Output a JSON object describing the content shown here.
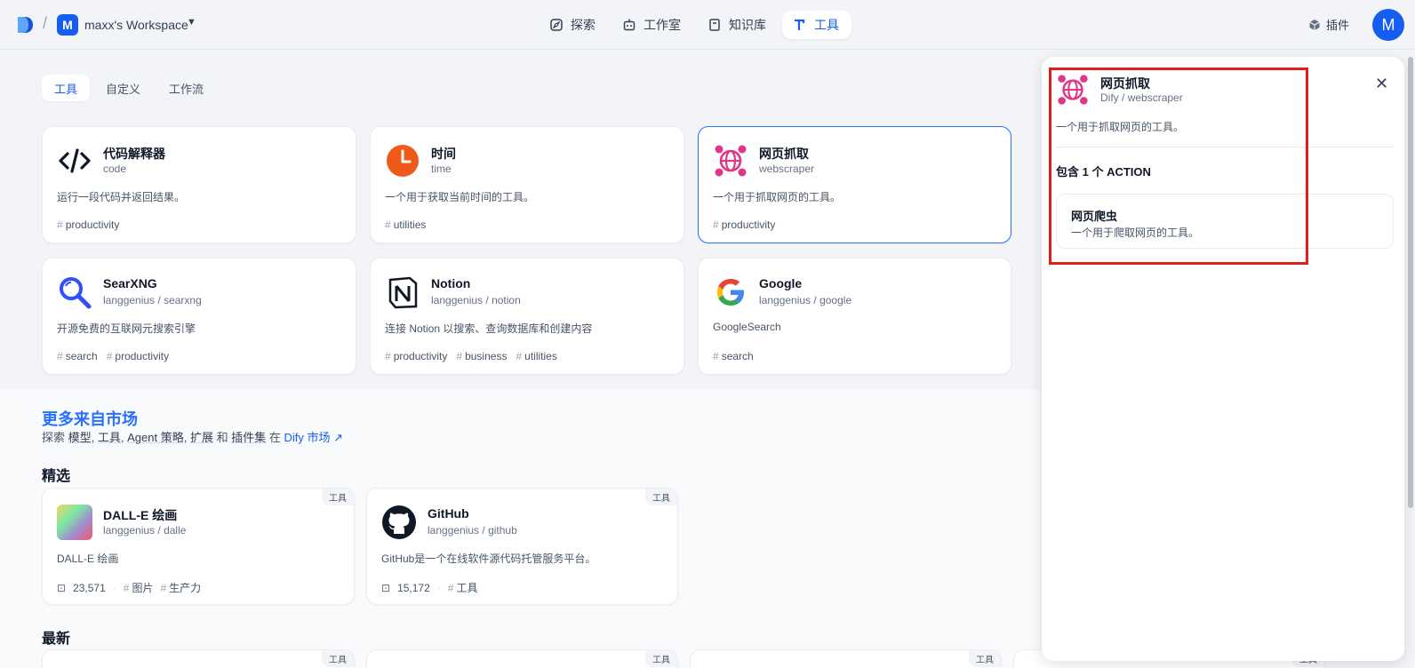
{
  "header": {
    "workspace_initial": "M",
    "workspace_name": "maxx's Workspace",
    "nav": [
      {
        "label": "探索",
        "icon": "compass-icon"
      },
      {
        "label": "工作室",
        "icon": "robot-icon"
      },
      {
        "label": "知识库",
        "icon": "book-icon"
      },
      {
        "label": "工具",
        "icon": "tool-icon",
        "active": true
      }
    ],
    "plugin_label": "插件",
    "user_initial": "M"
  },
  "subtabs": [
    "工具",
    "自定义",
    "工作流"
  ],
  "tools": [
    {
      "title": "代码解释器",
      "sub": "code",
      "desc": "运行一段代码并返回结果。",
      "tags": [
        "productivity"
      ]
    },
    {
      "title": "时间",
      "sub": "time",
      "desc": "一个用于获取当前时间的工具。",
      "tags": [
        "utilities"
      ]
    },
    {
      "title": "网页抓取",
      "sub": "webscraper",
      "desc": "一个用于抓取网页的工具。",
      "tags": [
        "productivity"
      ]
    },
    {
      "title": "SearXNG",
      "sub_author": "langgenius",
      "sub_name": "searxng",
      "desc": "开源免费的互联网元搜索引擎",
      "tags": [
        "search",
        "productivity"
      ]
    },
    {
      "title": "Notion",
      "sub_author": "langgenius",
      "sub_name": "notion",
      "desc": "连接 Notion 以搜索、查询数据库和创建内容",
      "tags": [
        "productivity",
        "business",
        "utilities"
      ]
    },
    {
      "title": "Google",
      "sub_author": "langgenius",
      "sub_name": "google",
      "desc": "GoogleSearch",
      "tags": [
        "search"
      ]
    }
  ],
  "marketplace": {
    "title": "更多来自市场",
    "desc_prefix": "探索",
    "links": [
      "模型",
      "工具",
      "Agent 策略",
      "扩展",
      "插件集"
    ],
    "and": "和",
    "at": "在",
    "market_link": "Dify 市场",
    "featured_title": "精选",
    "latest_title": "最新",
    "featured": [
      {
        "title": "DALL-E 绘画",
        "author": "langgenius",
        "name": "dalle",
        "desc": "DALL-E 绘画",
        "downloads": "23,571",
        "tags": [
          "图片",
          "生产力"
        ],
        "badge": "工具"
      },
      {
        "title": "GitHub",
        "author": "langgenius",
        "name": "github",
        "desc": "GitHub是一个在线软件源代码托管服务平台。",
        "downloads": "15,172",
        "tags": [
          "工具"
        ],
        "badge": "工具"
      }
    ],
    "latest_badge": "工具"
  },
  "drawer": {
    "title": "网页抓取",
    "author": "Dify",
    "name": "webscraper",
    "desc": "一个用于抓取网页的工具。",
    "section": "包含 1 个 ACTION",
    "action_title": "网页爬虫",
    "action_desc": "一个用于爬取网页的工具。"
  },
  "colors": {
    "accent": "#155eef",
    "highlight": "#e01e1e",
    "webscraper_pink": "#e0368a",
    "time_orange": "#ef5a1a"
  }
}
